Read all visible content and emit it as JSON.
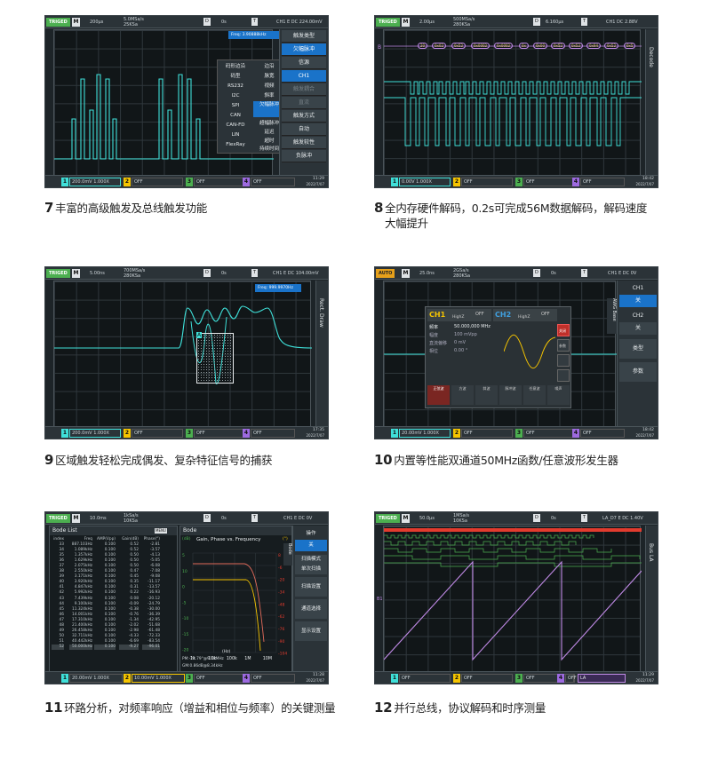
{
  "colors": {
    "cyan": "#3fe0d9",
    "yellow": "#f5c400",
    "purple": "#c08ae6",
    "green": "#4caf50",
    "menuBlue": "#1a73c9",
    "red": "#e23b2e"
  },
  "captions": {
    "c7": {
      "num": "7",
      "text": "丰富的高级触发及总线触发功能"
    },
    "c8": {
      "num": "8",
      "text": "全内存硬件解码，0.2s可完成56M数据解码，解码速度",
      "text2": "大幅提升"
    },
    "c9": {
      "num": "9",
      "text": "区域触发轻松完成偶发、复杂特征信号的捕获"
    },
    "c10": {
      "num": "10",
      "text": "内置等性能双通道50MHz函数/任意波形发生器"
    },
    "c11": {
      "num": "11",
      "text": "环路分析，对频率响应（增益和相位与频率）的关键测量"
    },
    "c12": {
      "num": "12",
      "text": "并行总线，协议解码和时序测量"
    }
  },
  "p7": {
    "badge": "TRIGED",
    "m": "M",
    "tb": "200μs",
    "sr": "5.0MSa/s",
    "mem": "25KSa",
    "d": "D",
    "dv": "0s",
    "t": "T",
    "trig": "CH1 E DC 224.00mV",
    "freq": "Freq: 3.90888kHz",
    "menu": [
      "触发类型",
      "欠幅脉冲",
      "信源",
      "CH1",
      "触发耦合",
      "直流",
      "触发方式",
      "自动",
      "触发较性",
      "负脉冲"
    ],
    "types_left": [
      "码形边沿",
      "码型",
      "RS232",
      "I2C",
      "SPI",
      "CAN",
      "CAN-FD",
      "LIN",
      "FlexRay"
    ],
    "types_right": [
      "边沿",
      "脉宽",
      "视频",
      "斜率",
      "欠幅脉冲",
      "超幅脉冲",
      "延迟",
      "超时",
      "持续时间",
      "建立保持"
    ],
    "ch1": "200.0mV 1.000X",
    "ch2": "OFF",
    "ch3": "OFF",
    "ch4": "OFF",
    "time": "11:29",
    "date": "2022/7/07"
  },
  "p8": {
    "badge": "TRIGED",
    "m": "M",
    "tb": "2.00μs",
    "sr": "500MSa/s",
    "mem": "280KSa",
    "d": "D",
    "dv": "6.160μs",
    "t": "T",
    "trig": "CH1 DC 2.88V",
    "bus": "B",
    "decode": [
      "20",
      "0x02",
      "0x52",
      "0x0002",
      "0x0002",
      "0x",
      "0x00",
      "0x52",
      "0x52",
      "0x94",
      "0x52",
      "0x5"
    ],
    "tab": "Decode",
    "ch1": "0.00V 1.000X",
    "ch2": "OFF",
    "ch3": "OFF",
    "ch4": "OFF",
    "time": "18:42",
    "date": "2022/7/07"
  },
  "p9": {
    "badge": "TRIGED",
    "m": "M",
    "tb": "5.00ns",
    "sr": "700MSa/s",
    "mem": "280KSa",
    "d": "D",
    "dv": "0s",
    "t": "T",
    "trig": "CH1 E DC 104.00mV",
    "freq": "Freq: 999.9970Hz",
    "tab": "Rect. Draw",
    "zone": "A",
    "ch1": "200.0mV 1.000X",
    "ch2": "OFF",
    "ch3": "OFF",
    "ch4": "OFF",
    "time": "17:35",
    "date": "2022/7/07"
  },
  "p10": {
    "badge": "AUTO",
    "m": "M",
    "tb": "25.0ns",
    "sr": "2GSa/s",
    "mem": "280KSa",
    "d": "D",
    "dv": "0s",
    "t": "T",
    "trig": "CH1 E DC 0V",
    "gen_ch1": "CH1",
    "gen_ch1_z": "HighZ",
    "gen_ch1_s": "OFF",
    "gen_ch2": "CH2",
    "gen_ch2_z": "HighZ",
    "gen_ch2_s": "OFF",
    "rows": [
      {
        "k": "频率",
        "v": "50.000,000 MHz"
      },
      {
        "k": "幅度",
        "v": "100 mVpp"
      },
      {
        "k": "直流偏移",
        "v": "0 mV"
      },
      {
        "k": "相位",
        "v": "0.00 °"
      }
    ],
    "waves": [
      "正弦波",
      "方波",
      "斜波",
      "脉冲波",
      "任意波",
      "噪声"
    ],
    "gen_btn1": "关闭",
    "gen_btn2": "参数",
    "side": {
      "tab": "AWG Base",
      "ch1": "CH1",
      "ch1v": "关",
      "ch2": "CH2",
      "ch2v": "关",
      "b1": "类型",
      "b2": "参数"
    },
    "ch1": "20.00mV 1.000X",
    "ch2": "OFF",
    "ch3": "OFF",
    "ch4": "OFF",
    "time": "18:42",
    "date": "2022/7/07"
  },
  "p11": {
    "badge": "TRIGED",
    "m": "M",
    "tb": "10.0ms",
    "sr": "1kSa/s",
    "mem": "10KSa",
    "d": "D",
    "dv": "0s",
    "t": "T",
    "trig": "CH1 E DC 0V",
    "list_title": "Bode List",
    "menu_btn": "MENU",
    "plot_title": "Bode",
    "headers": [
      "index",
      "Freq",
      "AMP(Vpp)",
      "Gain(dB)",
      "Phase(°)"
    ],
    "rows": [
      [
        "33",
        "887.103Hz",
        "0.100",
        "0.52",
        "-2.81"
      ],
      [
        "34",
        "1.089kHz",
        "0.100",
        "0.52",
        "-3.57"
      ],
      [
        "35",
        "1.357kHz",
        "0.100",
        "0.50",
        "-4.13"
      ],
      [
        "36",
        "1.629kHz",
        "0.100",
        "0.50",
        "-5.05"
      ],
      [
        "37",
        "2.075kHz",
        "0.100",
        "0.50",
        "-6.08"
      ],
      [
        "38",
        "2.550kHz",
        "0.100",
        "0.47",
        "-7.08"
      ],
      [
        "39",
        "3.171kHz",
        "0.100",
        "0.45",
        "-9.08"
      ],
      [
        "40",
        "3.920kHz",
        "0.100",
        "0.35",
        "-11.17"
      ],
      [
        "41",
        "4.847kHz",
        "0.100",
        "0.31",
        "-13.57"
      ],
      [
        "42",
        "5.992kHz",
        "0.100",
        "0.22",
        "-16.93"
      ],
      [
        "43",
        "7.439kHz",
        "0.100",
        "0.08",
        "-20.12"
      ],
      [
        "44",
        "9.100kHz",
        "0.100",
        "-0.09",
        "-24.79"
      ],
      [
        "45",
        "11.324kHz",
        "0.100",
        "-0.38",
        "-30.00"
      ],
      [
        "46",
        "14.001kHz",
        "0.100",
        "-0.76",
        "-36.39"
      ],
      [
        "47",
        "17.310kHz",
        "0.100",
        "-1.34",
        "-42.95"
      ],
      [
        "48",
        "21.400kHz",
        "0.100",
        "-2.02",
        "-51.68"
      ],
      [
        "49",
        "26.458kHz",
        "0.100",
        "-2.98",
        "-61.48"
      ],
      [
        "50",
        "32.711kHz",
        "0.100",
        "-4.33",
        "-72.33"
      ],
      [
        "51",
        "40.442kHz",
        "0.100",
        "-6.69",
        "-83.54"
      ],
      [
        "52",
        "50.000kHz",
        "0.100",
        "-9.27",
        "-96.01"
      ]
    ],
    "plot_head": "Gain, Phase vs. Frequency",
    "gain_unit": "(dB)",
    "phase_unit": "(°)",
    "gain_ticks": [
      "5",
      "10",
      "0",
      "-5",
      "-10",
      "-15",
      "-20"
    ],
    "phase_ticks": [
      "8",
      "-6",
      "-20",
      "-34",
      "-48",
      "-62",
      "-76",
      "-90",
      "-104"
    ],
    "x_ticks": [
      "1k",
      "10k",
      "100k",
      "1M",
      "10M"
    ],
    "xlabel": "(Hz)",
    "pm": "PM:-24.79°@9.18MHz",
    "gm": "GM:0.86dB@8.34kHz",
    "side": {
      "tab": "Bode",
      "items": [
        "操作",
        "关",
        "扫描模式",
        "单次扫描",
        "扫描设置",
        "通道选择",
        "显示设置"
      ]
    },
    "ch1": "20.00mV 1.000X",
    "ch2": "10.00mV 1.000X",
    "ch3": "OFF",
    "ch4": "OFF",
    "time": "11:28",
    "date": "2022/7/07"
  },
  "p12": {
    "badge": "TRIGED",
    "m": "M",
    "tb": "50.0μs",
    "sr": "1MSa/s",
    "mem": "10KSa",
    "d": "D",
    "dv": "0s",
    "t": "T",
    "trig": "LA_D7 E DC 1.40V",
    "tab": "Bus LA",
    "b1": "B1",
    "ch1": "OFF",
    "ch2": "OFF",
    "ch3": "OFF",
    "ch4": "OFF",
    "la": "LA",
    "time": "11:29",
    "date": "2022/7/07"
  }
}
